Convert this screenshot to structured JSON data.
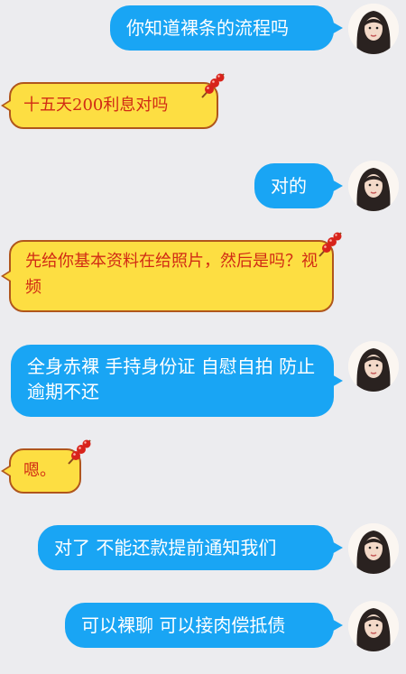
{
  "chat": {
    "messages": [
      {
        "side": "out",
        "text": "你知道裸条的流程吗"
      },
      {
        "side": "in",
        "text": "十五天200利息对吗"
      },
      {
        "side": "out",
        "text": "对的"
      },
      {
        "side": "in",
        "text": "先给你基本资料在给照片，然后是吗？视频"
      },
      {
        "side": "out",
        "text": "全身赤裸 手持身份证 自慰自拍 防止逾期不还"
      },
      {
        "side": "in",
        "text": "嗯。"
      },
      {
        "side": "out",
        "text": "对了 不能还款提前通知我们"
      },
      {
        "side": "out",
        "text": "可以裸聊 可以接肉偿抵债"
      }
    ]
  },
  "colors": {
    "background": "#ececef",
    "outgoing_bubble": "#19a5f4",
    "outgoing_text": "#ffffff",
    "incoming_bubble": "#fdde42",
    "incoming_border": "#b0561c",
    "incoming_text": "#d12b14"
  },
  "icons": {
    "incoming_decoration": "candied-haws-icon",
    "sender_avatar": "user-avatar"
  }
}
